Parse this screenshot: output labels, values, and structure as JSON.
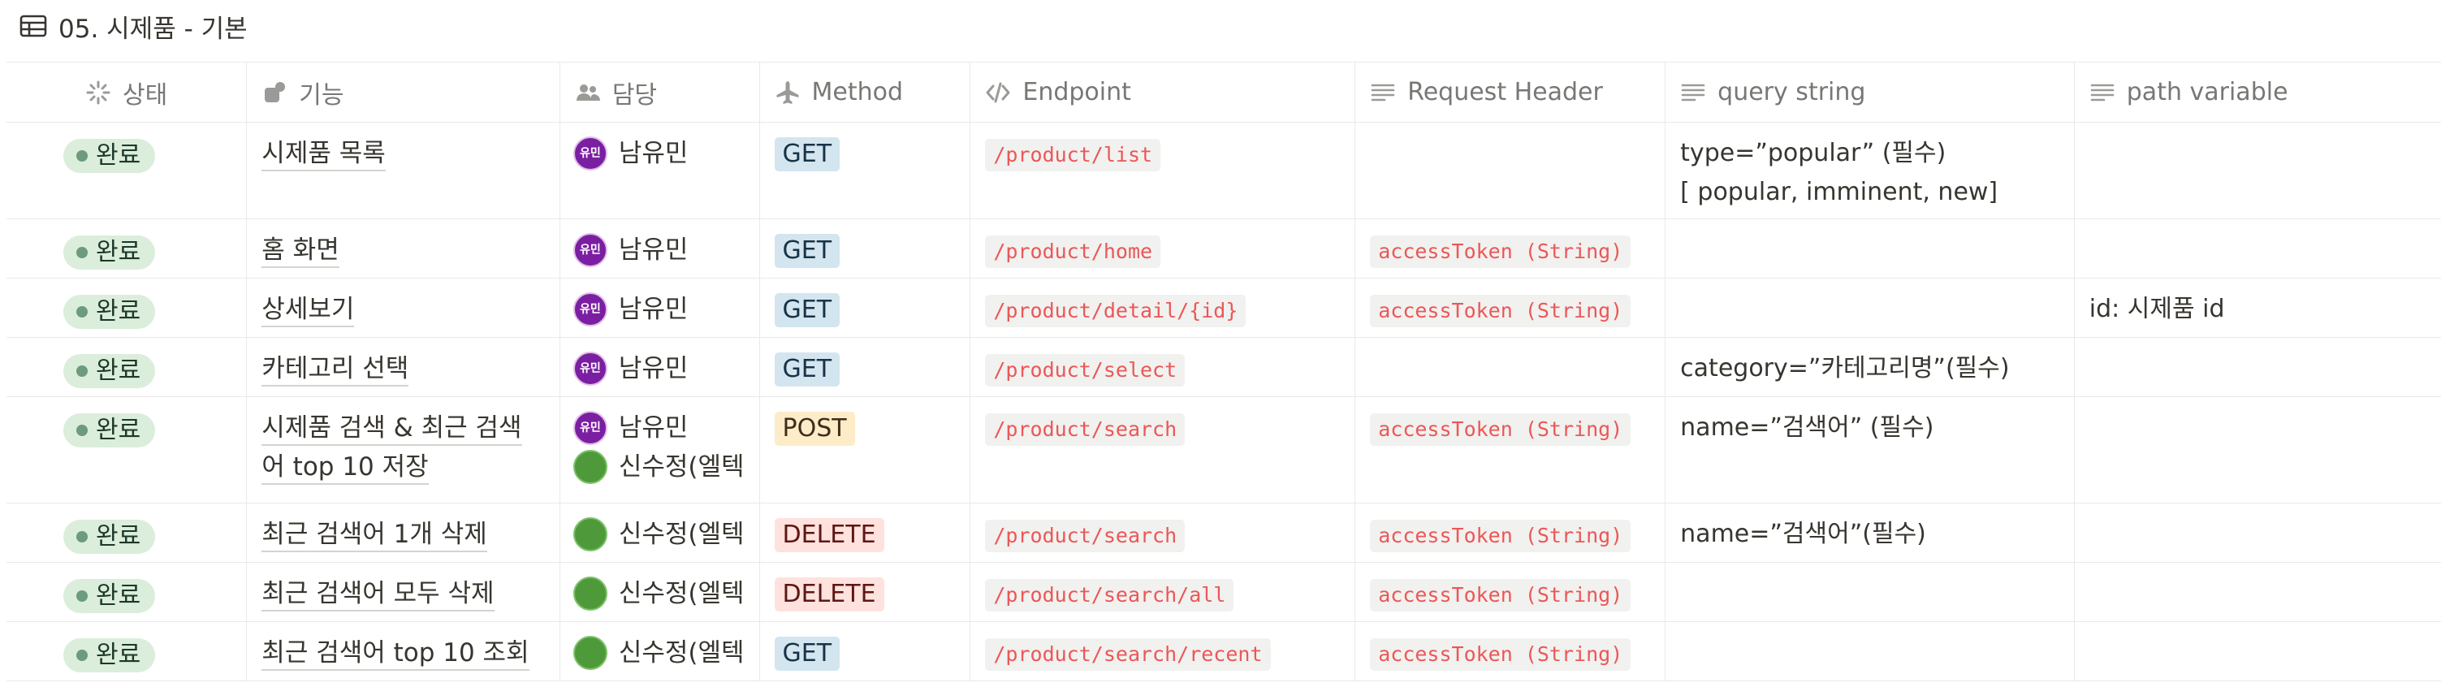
{
  "page": {
    "title": "05. 시제품 - 기본",
    "title_icon": "table-icon"
  },
  "columns": [
    {
      "label": "상태",
      "icon": "status-icon"
    },
    {
      "label": "기능",
      "icon": "shapes-icon"
    },
    {
      "label": "담당",
      "icon": "people-icon"
    },
    {
      "label": "Method",
      "icon": "airplane-icon"
    },
    {
      "label": "Endpoint",
      "icon": "code-icon"
    },
    {
      "label": "Request Header",
      "icon": "text-lines-icon"
    },
    {
      "label": "query string",
      "icon": "text-lines-icon"
    },
    {
      "label": "path variable",
      "icon": "text-lines-icon"
    }
  ],
  "rows": [
    {
      "status": "완료",
      "feature": "시제품 목록",
      "assignees": [
        {
          "name": "남유민",
          "avatar": "유민",
          "color": "#7b1fa2"
        }
      ],
      "method": "GET",
      "endpoint": "/product/list",
      "header": "",
      "query": "type=”popular” (필수)",
      "query2": "[ popular, imminent, new]",
      "path": ""
    },
    {
      "status": "완료",
      "feature": "홈 화면",
      "assignees": [
        {
          "name": "남유민",
          "avatar": "유민",
          "color": "#7b1fa2"
        }
      ],
      "method": "GET",
      "endpoint": "/product/home",
      "header": "accessToken (String)",
      "query": "",
      "query2": "",
      "path": ""
    },
    {
      "status": "완료",
      "feature": "상세보기",
      "assignees": [
        {
          "name": "남유민",
          "avatar": "유민",
          "color": "#7b1fa2"
        }
      ],
      "method": "GET",
      "endpoint": "/product/detail/{id}",
      "header": "accessToken (String)",
      "query": "",
      "query2": "",
      "path": "id: 시제품 id"
    },
    {
      "status": "완료",
      "feature": "카테고리 선택",
      "assignees": [
        {
          "name": "남유민",
          "avatar": "유민",
          "color": "#7b1fa2"
        }
      ],
      "method": "GET",
      "endpoint": "/product/select",
      "header": "",
      "query": "category=”카테고리명”(필수)",
      "query2": "",
      "path": ""
    },
    {
      "status": "완료",
      "feature": "시제품 검색 & 최근 검색어 top 10 저장",
      "assignees": [
        {
          "name": "남유민",
          "avatar": "유민",
          "color": "#7b1fa2"
        },
        {
          "name": "신수정(엘텍",
          "avatar": "",
          "color": "#4e9a3a"
        }
      ],
      "method": "POST",
      "endpoint": "/product/search",
      "header": "accessToken (String)",
      "query": "name=”검색어” (필수)",
      "query2": "",
      "path": ""
    },
    {
      "status": "완료",
      "feature": "최근 검색어 1개 삭제",
      "assignees": [
        {
          "name": "신수정(엘텍",
          "avatar": "",
          "color": "#4e9a3a"
        }
      ],
      "method": "DELETE",
      "endpoint": "/product/search",
      "header": "accessToken (String)",
      "query": "name=”검색어”(필수)",
      "query2": "",
      "path": ""
    },
    {
      "status": "완료",
      "feature": "최근 검색어 모두 삭제",
      "assignees": [
        {
          "name": "신수정(엘텍",
          "avatar": "",
          "color": "#4e9a3a"
        }
      ],
      "method": "DELETE",
      "endpoint": "/product/search/all",
      "header": "accessToken (String)",
      "query": "",
      "query2": "",
      "path": ""
    },
    {
      "status": "완료",
      "feature": "최근 검색어 top 10 조회",
      "assignees": [
        {
          "name": "신수정(엘텍",
          "avatar": "",
          "color": "#4e9a3a"
        }
      ],
      "method": "GET",
      "endpoint": "/product/search/recent",
      "header": "accessToken (String)",
      "query": "",
      "query2": "",
      "path": ""
    }
  ],
  "colors": {
    "status_bg": "#dbeddb",
    "status_dot": "#6c9b7d",
    "get_bg": "#d3e5ef",
    "post_bg": "#fdecc8",
    "delete_bg": "#ffe2dd",
    "code_text": "#eb5757",
    "code_bg": "#f1f1ef",
    "border": "#e9e9e7"
  }
}
